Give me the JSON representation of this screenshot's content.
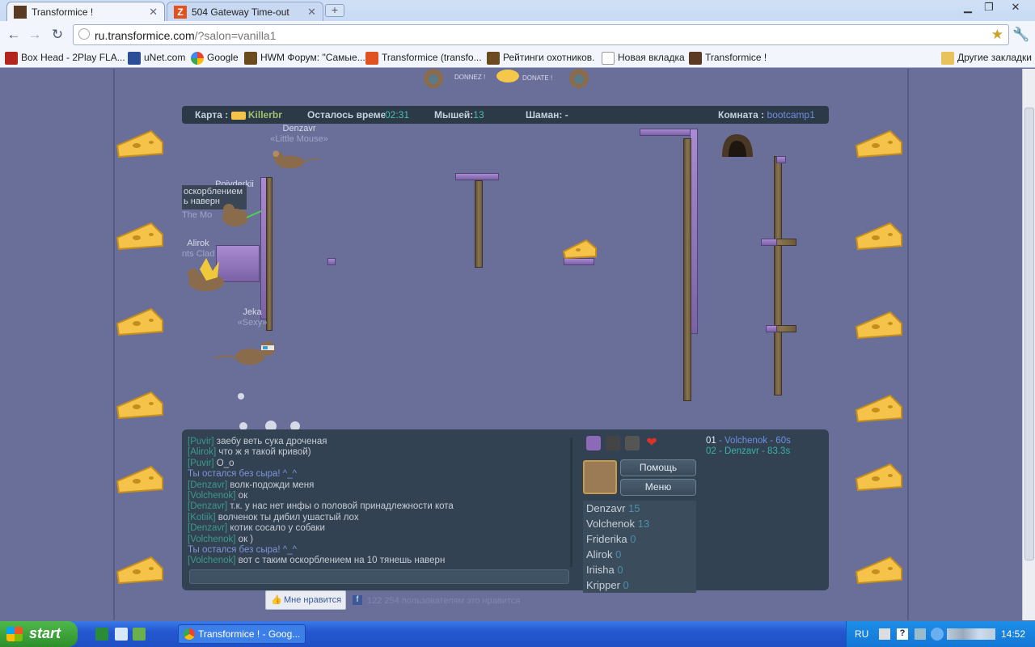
{
  "browser": {
    "tabs": [
      {
        "label": "Transformice !",
        "active": true
      },
      {
        "label": "504 Gateway Time-out",
        "active": false
      }
    ],
    "url_host": "ru.transformice.com",
    "url_path": "/?salon=vanilla1",
    "bookmarks": [
      "Box Head - 2Play FLA...",
      "uNet.com",
      "Google",
      "HWM Форум: \"Самые...",
      "Transformice (transfo...",
      "Рейтинги охотников.",
      "Новая вкладка",
      "Transformice !"
    ],
    "other_bookmarks": "Другие закладки"
  },
  "banner": {
    "left": "DONNEZ !",
    "right": "DONATE !"
  },
  "hud": {
    "map_label": "Карта :",
    "map_value": "Killerbr",
    "time_label": "Осталось времен",
    "time_value": "02:31",
    "mice_label": "Мышей:",
    "mice_value": "13",
    "shaman_label": "Шаман:",
    "shaman_value": "-",
    "room_label": "Комната :",
    "room_value": "bootcamp1"
  },
  "players_in_game": [
    {
      "name": "Denzavr",
      "title": "«Little Mouse»"
    },
    {
      "name": "Jeka",
      "title": "«Sexy»"
    },
    {
      "name": "Alirok",
      "title": "nts Clad"
    }
  ],
  "overlap_text": {
    "a": "Poiyderkii",
    "b": "оскорблением",
    "c": "ь наверн",
    "d": "The Mo"
  },
  "chat": [
    {
      "nick": "[Puvir]",
      "text": "заебу веть сука дроченая"
    },
    {
      "nick": "[Alirok]",
      "text": "что ж я такой кривой)"
    },
    {
      "nick": "[Puvir]",
      "text": "О_о"
    },
    {
      "system": "Ты остался без сыра! ^_^"
    },
    {
      "nick": "[Denzavr]",
      "text": "волк-подожди меня"
    },
    {
      "nick": "[Volchenok]",
      "text": "ок"
    },
    {
      "nick": "[Denzavr]",
      "text": "т.к. у нас нет инфы о половой принадлежности кота"
    },
    {
      "nick": "[Kotiik]",
      "text": "волченок ты дибил ушастый лох"
    },
    {
      "nick": "[Denzavr]",
      "text": "котик сосало у собаки"
    },
    {
      "nick": "[Volchenok]",
      "text": "ок )"
    },
    {
      "system": "Ты остался без сыра! ^_^"
    },
    {
      "nick": "[Volchenok]",
      "text": "вот с таким оскорблением на 10 тянешь наверн"
    }
  ],
  "side": {
    "help_label": "Помощь",
    "menu_label": "Меню",
    "players": [
      {
        "name": "Denzavr",
        "score": "15"
      },
      {
        "name": "Volchenok",
        "score": "13"
      },
      {
        "name": "Friderika",
        "score": "0"
      },
      {
        "name": "Alirok",
        "score": "0"
      },
      {
        "name": "Iriisha",
        "score": "0"
      },
      {
        "name": "Kripper",
        "score": "0"
      }
    ]
  },
  "records": [
    {
      "rank": "01",
      "text": " - Volchenok - 60s"
    },
    {
      "rank": "02",
      "text": " - Denzavr - 83.3s"
    }
  ],
  "facebook": {
    "like_label": "Мне нравится",
    "count_text": "122 254 пользователям это нравится"
  },
  "taskbar": {
    "start_label": "start",
    "task_label": "Transformice ! - Goog...",
    "lang": "RU",
    "clock": "14:52"
  },
  "colors": {
    "game_bg": "#6a6f9a",
    "panel_bg": "#324252",
    "chat_nick": "#3d9a8c",
    "system": "#7f94d6",
    "timer": "#4bbfb3"
  }
}
